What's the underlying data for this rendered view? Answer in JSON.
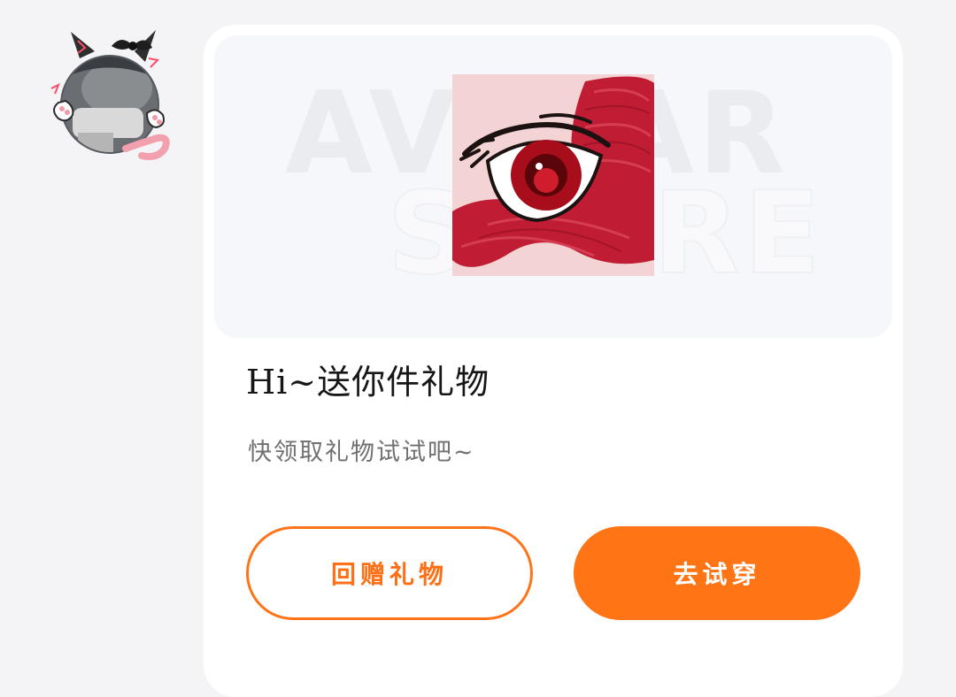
{
  "card": {
    "banner": {
      "watermark_line1": "AVATAR",
      "watermark_line2": "STORE",
      "product_icon": "red-eye-makeup-icon"
    },
    "title": "Hi~送你件礼物",
    "subtitle": "快领取礼物试试吧~",
    "buttons": {
      "gift_back_label": "回赠礼物",
      "try_on_label": "去试穿"
    }
  },
  "sender": {
    "avatar_icon": "cat-ear-avatar-icon"
  },
  "colors": {
    "accent": "#ff7414",
    "title_text": "#161616",
    "subtitle_text": "#707070",
    "card_background": "#ffffff",
    "page_background": "#f4f4f6"
  }
}
